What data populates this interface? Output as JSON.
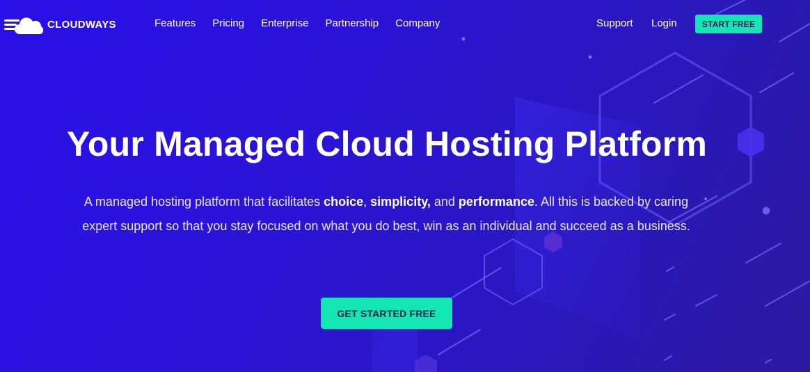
{
  "brand": {
    "name": "CLOUDWAYS",
    "logo_icon": "cloud-icon"
  },
  "nav": {
    "items": [
      "Features",
      "Pricing",
      "Enterprise",
      "Partnership",
      "Company"
    ],
    "support": "Support",
    "login": "Login",
    "start_free": "START FREE"
  },
  "hero": {
    "title": "Your Managed Cloud Hosting Platform",
    "subtitle": {
      "part1": "A managed hosting platform that facilitates ",
      "choice": "choice",
      "sep1": ", ",
      "simplicity": "simplicity,",
      "sep2": " and ",
      "performance": "performance",
      "part2": ". All this is backed by caring expert support so that you stay focused on what you do best, win as an individual and succeed as a business."
    },
    "cta": "GET STARTED FREE"
  },
  "colors": {
    "accent": "#14e6b3",
    "background": "#2a14d0",
    "button_text": "#141a5c"
  }
}
